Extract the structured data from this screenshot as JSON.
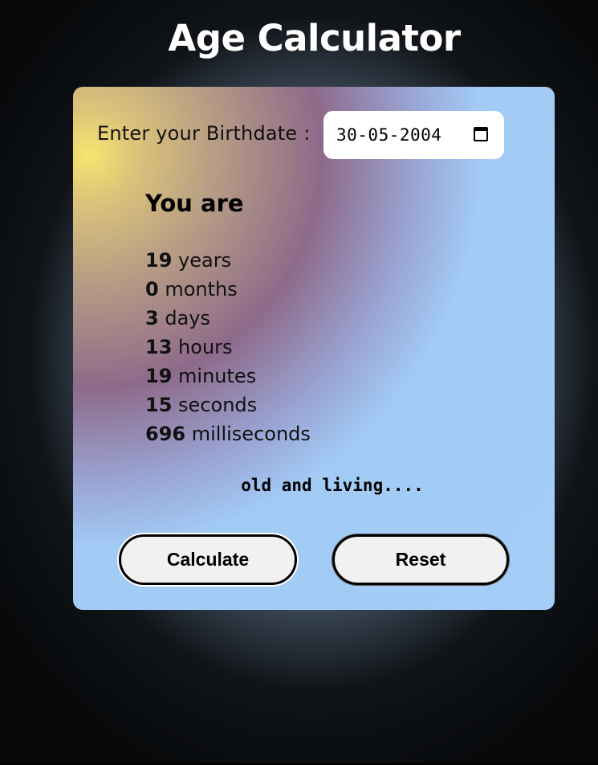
{
  "header": {
    "title": "Age Calculator"
  },
  "form": {
    "birthdate_label": "Enter your Birthdate :",
    "birthdate_value": "30-05-2004",
    "calendar_icon": "calendar-icon"
  },
  "result": {
    "heading": "You are",
    "rows": [
      {
        "value": "19",
        "unit": "years"
      },
      {
        "value": "0",
        "unit": "months"
      },
      {
        "value": "3",
        "unit": "days"
      },
      {
        "value": "13",
        "unit": "hours"
      },
      {
        "value": "19",
        "unit": "minutes"
      },
      {
        "value": "15",
        "unit": "seconds"
      },
      {
        "value": "696",
        "unit": "milliseconds"
      }
    ],
    "footer": "old and living...."
  },
  "buttons": {
    "calculate_label": "Calculate",
    "reset_label": "Reset"
  },
  "colors": {
    "card_yellow": "#f8e470",
    "card_purple": "#8e6a8a",
    "card_blue": "#a3cdf7",
    "button_bg": "#f1f1f1"
  }
}
